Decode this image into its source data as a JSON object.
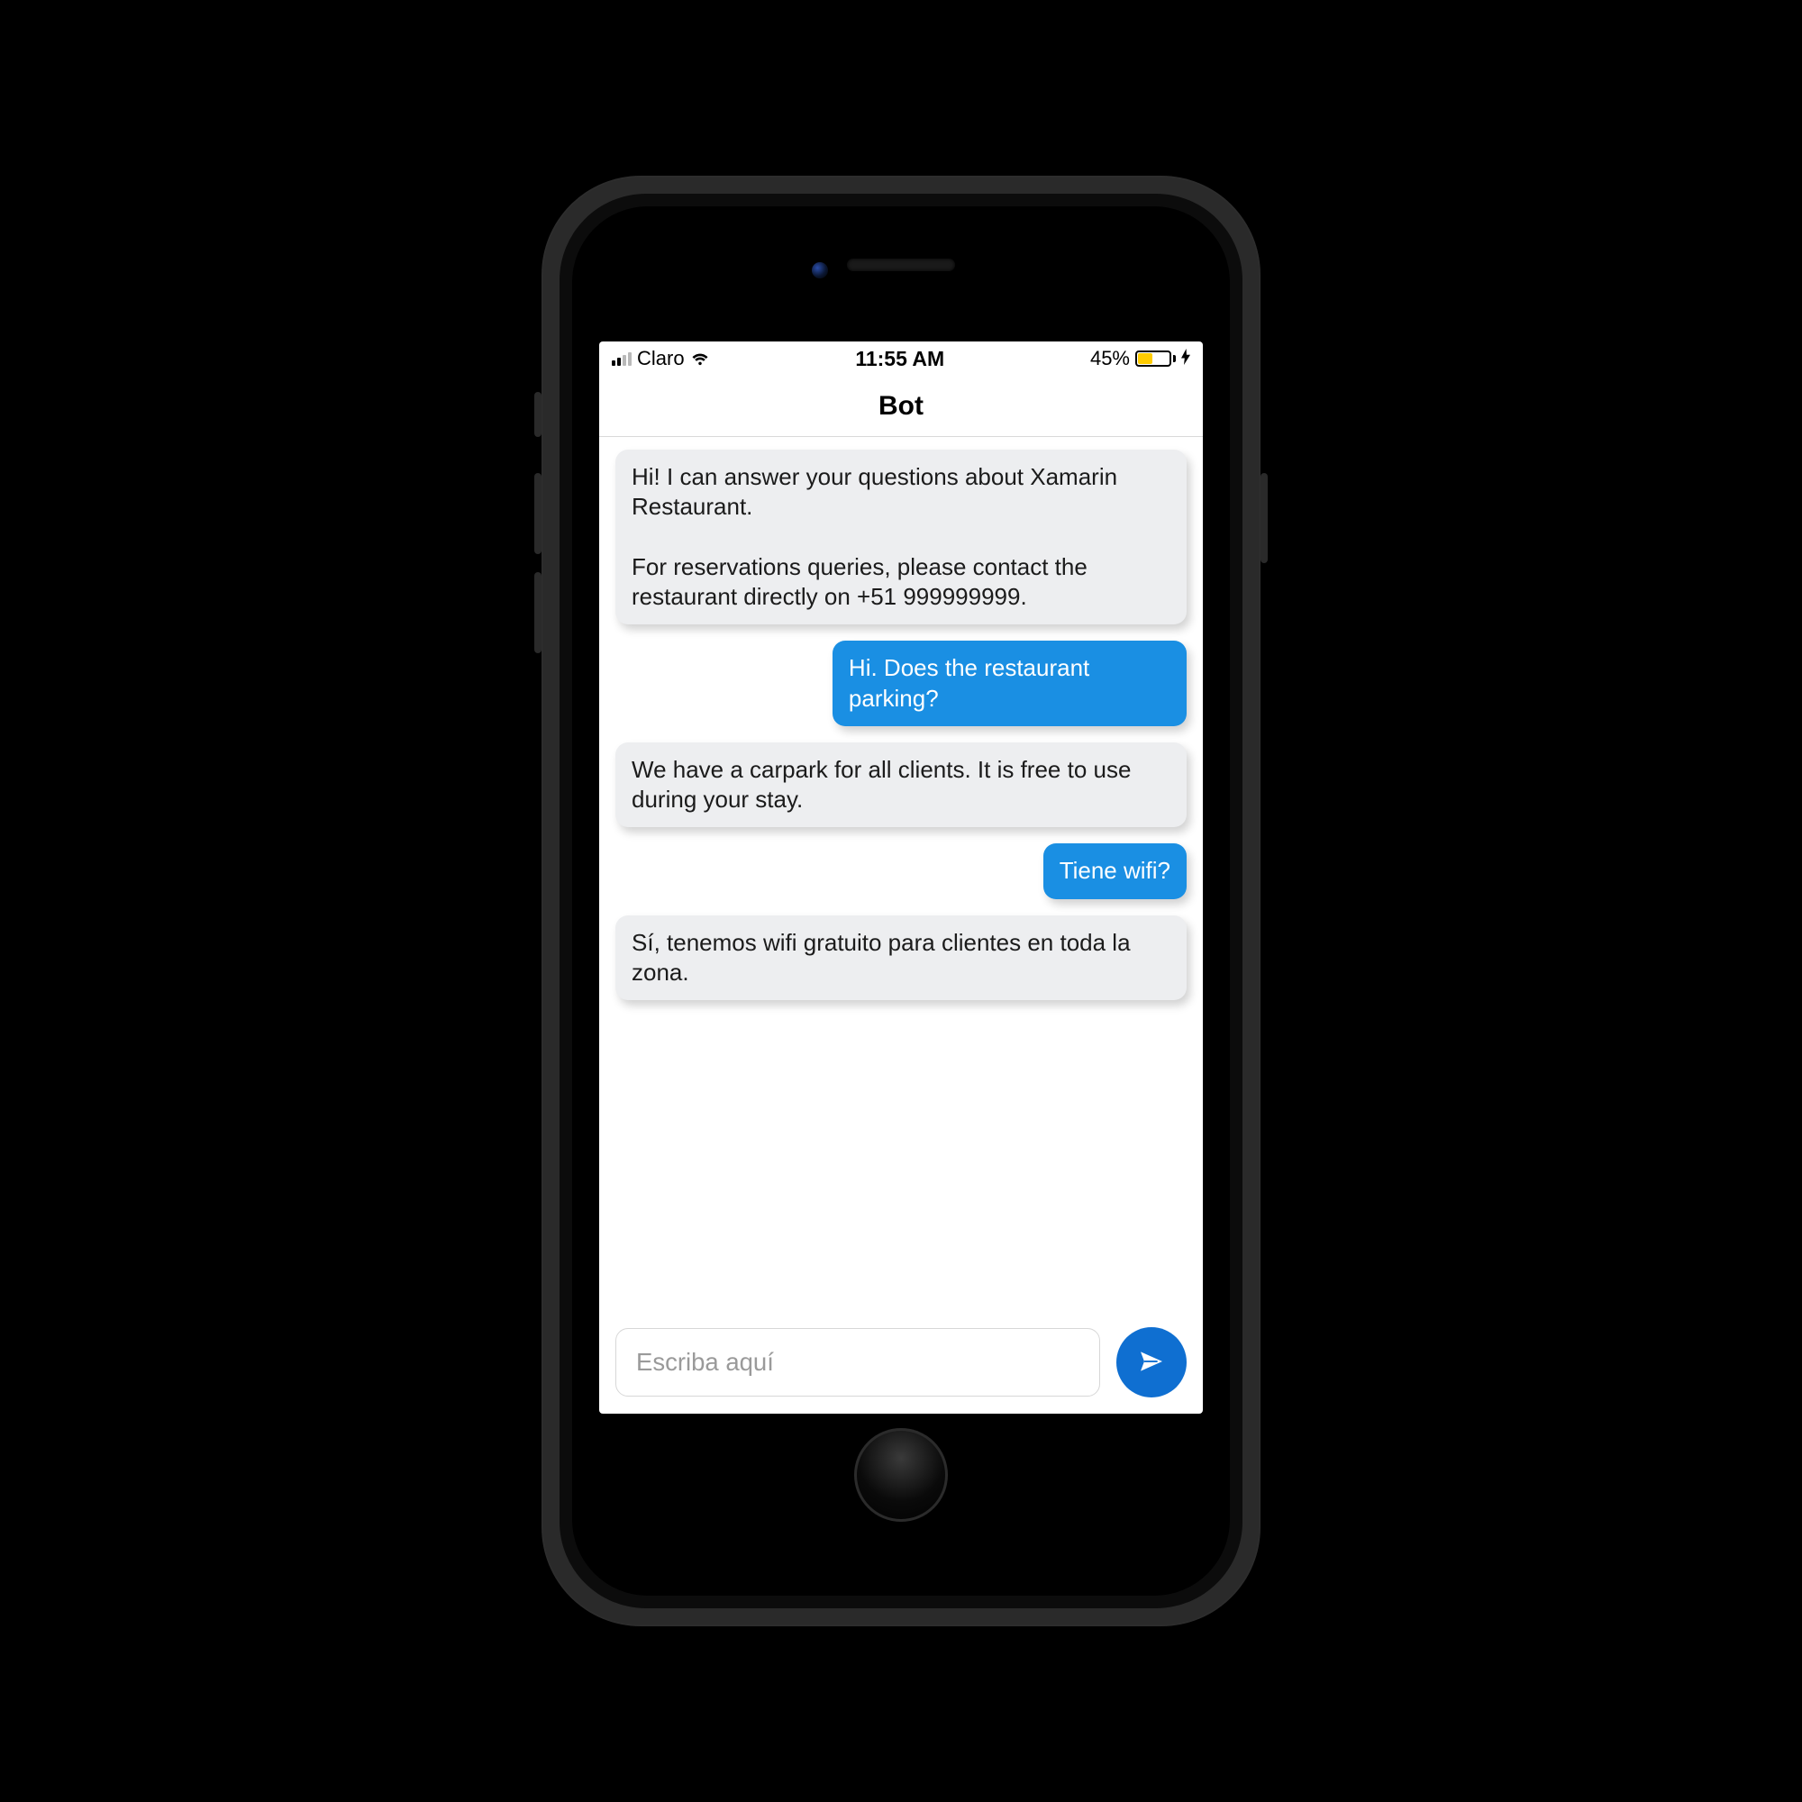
{
  "statusbar": {
    "carrier": "Claro",
    "time": "11:55 AM",
    "battery_percent_label": "45%",
    "battery_fill_percent": 45,
    "charging": true,
    "signal_bars_active": 2,
    "signal_bars_total": 4
  },
  "header": {
    "title": "Bot"
  },
  "messages": [
    {
      "sender": "bot",
      "text": "Hi! I can answer your questions about Xamarin Restaurant.\n\nFor reservations queries, please contact the restaurant directly on +51 999999999."
    },
    {
      "sender": "user",
      "text": "Hi. Does the restaurant parking?"
    },
    {
      "sender": "bot",
      "text": "We have a carpark for all clients. It is free to use during your stay."
    },
    {
      "sender": "user",
      "text": "Tiene wifi?"
    },
    {
      "sender": "bot",
      "text": "Sí, tenemos wifi gratuito para clientes en toda la zona."
    }
  ],
  "input": {
    "placeholder": "Escriba aquí",
    "value": ""
  },
  "colors": {
    "user_bubble": "#1a8fe3",
    "bot_bubble": "#edeef0",
    "send_button": "#0f6fd1",
    "battery_fill": "#ffcc00"
  }
}
